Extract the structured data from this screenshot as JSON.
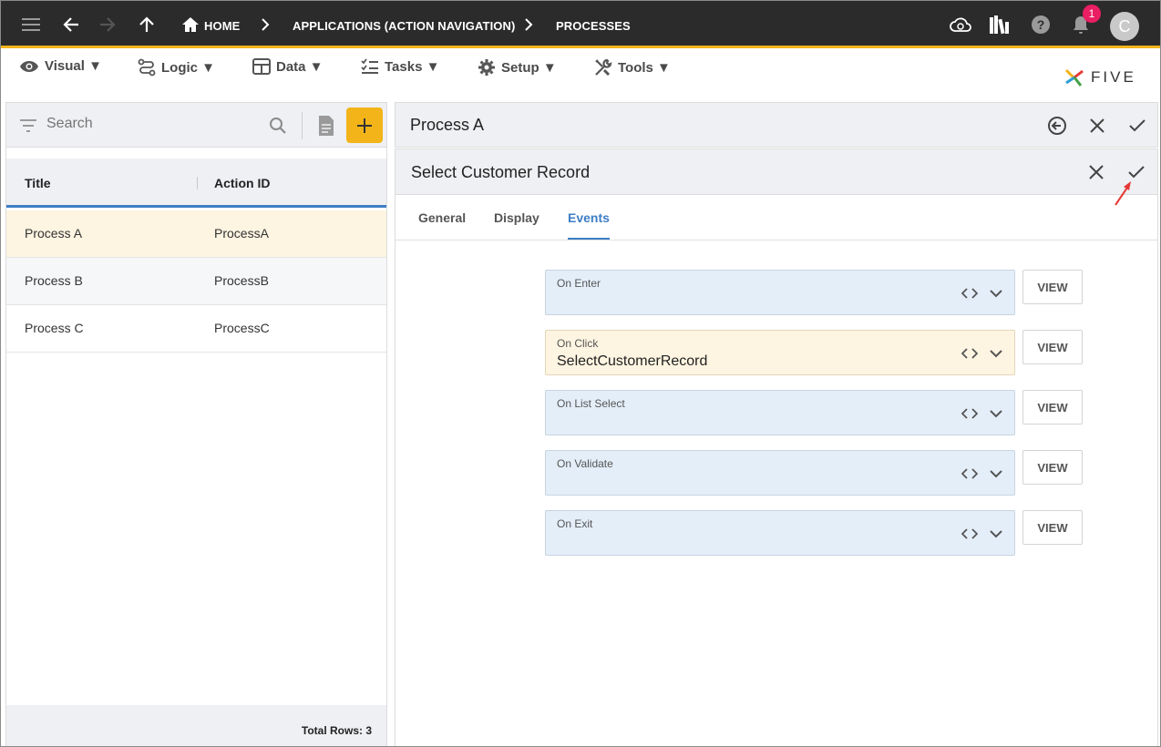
{
  "topbar": {
    "breadcrumbs": [
      {
        "label": "HOME"
      },
      {
        "label": "APPLICATIONS (ACTION NAVIGATION)"
      },
      {
        "label": "PROCESSES"
      }
    ],
    "notification_count": "1",
    "avatar_initial": "C"
  },
  "menu": {
    "items": [
      {
        "label": "Visual ▼",
        "icon": "eye-icon"
      },
      {
        "label": "Logic ▼",
        "icon": "logic-icon"
      },
      {
        "label": "Data ▼",
        "icon": "table-icon"
      },
      {
        "label": "Tasks ▼",
        "icon": "tasks-icon"
      },
      {
        "label": "Setup ▼",
        "icon": "gear-icon"
      },
      {
        "label": "Tools ▼",
        "icon": "tools-icon"
      }
    ],
    "logo_text": "FIVE"
  },
  "list": {
    "search_placeholder": "Search",
    "columns": [
      "Title",
      "Action ID"
    ],
    "rows": [
      {
        "title": "Process A",
        "action_id": "ProcessA",
        "selected": true
      },
      {
        "title": "Process B",
        "action_id": "ProcessB",
        "selected": false
      },
      {
        "title": "Process C",
        "action_id": "ProcessC",
        "selected": false
      }
    ],
    "footer": "Total Rows: 3"
  },
  "record": {
    "title": "Process A"
  },
  "form": {
    "title": "Select Customer Record",
    "tabs": [
      "General",
      "Display",
      "Events"
    ],
    "active_tab": "Events",
    "fields": [
      {
        "label": "On Enter",
        "value": ""
      },
      {
        "label": "On Click",
        "value": "SelectCustomerRecord"
      },
      {
        "label": "On List Select",
        "value": ""
      },
      {
        "label": "On Validate",
        "value": ""
      },
      {
        "label": "On Exit",
        "value": ""
      }
    ],
    "view_label": "VIEW"
  },
  "colors": {
    "accent": "#f3b41a",
    "active_tab": "#3d7ec5",
    "selected_row": "#fdf4e1",
    "annotation_arrow": "#e53935"
  }
}
